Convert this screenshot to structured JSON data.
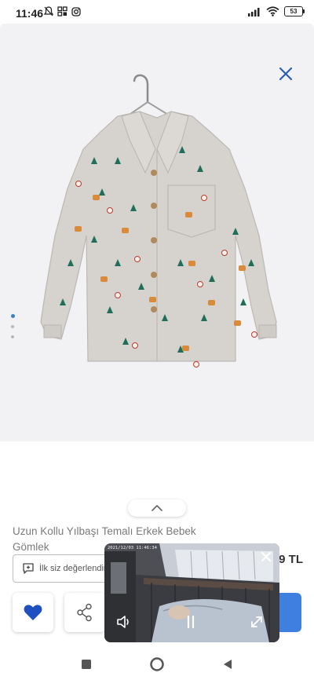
{
  "status_bar": {
    "time": "11:46",
    "battery": "53"
  },
  "product": {
    "title": "Uzun Kollu Yılbaşı Temalı Erkek Bebek Gömlek",
    "price_partial": "9 TL",
    "review_label": "İlk siz değerlendirin",
    "image_pages": 3,
    "active_image_index": 0
  },
  "pip_video": {
    "timestamp": "2021/12/03  11:46:34"
  },
  "icons": {
    "close": "close-icon",
    "chevron": "chevron-up-icon",
    "review": "comment-plus-icon",
    "favorite": "heart-icon",
    "share": "share-icon",
    "pip_mute": "speaker-icon",
    "pip_pause": "pause-icon",
    "pip_expand": "expand-icon",
    "pip_close": "close-icon",
    "nav_recents": "square-icon",
    "nav_home": "circle-icon",
    "nav_back": "triangle-back-icon"
  },
  "colors": {
    "accent": "#3f7fe0",
    "heart": "#1e50c0",
    "close": "#2b5fb5",
    "shirt": "#d6d3cf"
  }
}
